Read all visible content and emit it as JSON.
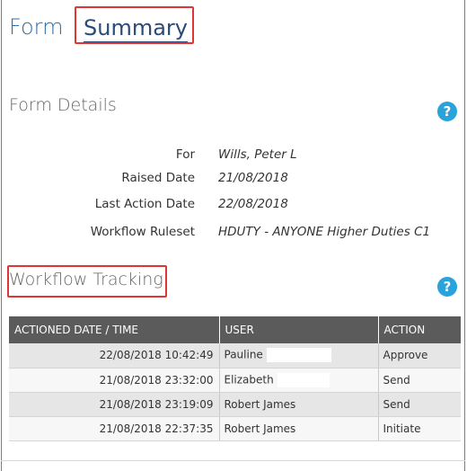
{
  "tabs": {
    "form": "Form",
    "summary": "Summary"
  },
  "form_details": {
    "title": "Form Details",
    "help": "?",
    "rows": [
      {
        "label": "For",
        "value": "Wills, Peter L"
      },
      {
        "label": "Raised Date",
        "value": "21/08/2018"
      },
      {
        "label": "Last Action Date",
        "value": "22/08/2018"
      },
      {
        "label": "Workflow Ruleset",
        "value": "HDUTY - ANYONE Higher Duties C1"
      }
    ]
  },
  "workflow_tracking": {
    "title": "Workflow Tracking",
    "help": "?",
    "columns": [
      "ACTIONED DATE / TIME",
      "USER",
      "ACTION"
    ],
    "rows": [
      {
        "datetime": "22/08/2018 10:42:49",
        "user": "Pauline",
        "action": "Approve"
      },
      {
        "datetime": "21/08/2018 23:32:00",
        "user": "Elizabeth",
        "action": "Send"
      },
      {
        "datetime": "21/08/2018 23:19:09",
        "user": "Robert James",
        "action": "Send"
      },
      {
        "datetime": "21/08/2018 22:37:35",
        "user": "Robert James",
        "action": "Initiate"
      }
    ]
  },
  "colors": {
    "tab_form": "#2f6fa8",
    "highlight_box": "#e03535",
    "help_icon": "#29a3dc",
    "table_header": "#5b5b5b"
  }
}
